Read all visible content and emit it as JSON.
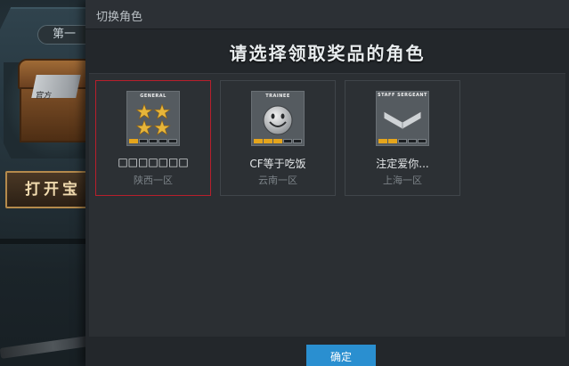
{
  "background_page": {
    "event_pill_label": "第一",
    "open_button_label": "打开宝",
    "chest_plate_text": "官方"
  },
  "dialog": {
    "title": "切换角色",
    "heading": "请选择领取奖品的角色",
    "confirm_label": "确定"
  },
  "roles": [
    {
      "rank_label": "GENERAL",
      "rank_icon": "four-gold-stars-icon",
      "exp_segments_filled": 1,
      "exp_segments_total": 5,
      "name": "□□□□□□□",
      "server": "陕西一区",
      "selected": true
    },
    {
      "rank_label": "TRAINEE",
      "rank_icon": "smiley-face-icon",
      "exp_segments_filled": 3,
      "exp_segments_total": 5,
      "name": "CF等于吃饭",
      "server": "云南一区",
      "selected": false
    },
    {
      "rank_label": "STAFF SERGEANT",
      "rank_icon": "chevron-insignia-icon",
      "exp_segments_filled": 2,
      "exp_segments_total": 5,
      "name": "注定爱你...",
      "server": "上海一区",
      "selected": false
    }
  ],
  "colors": {
    "selected_border": "#b81f2c",
    "confirm_button": "#2a8fd0",
    "exp_fill": "#e5a51c"
  }
}
